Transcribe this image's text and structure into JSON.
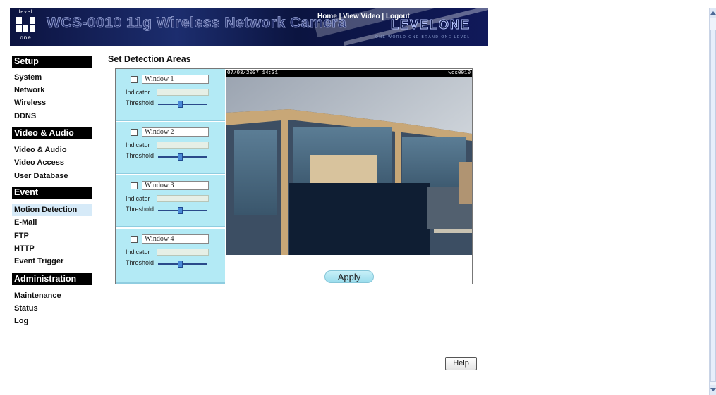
{
  "header": {
    "logo": {
      "top_text": "level",
      "bottom_text": "one"
    },
    "product_title": "WCS-0010 11g Wireless Network Camera",
    "brand": "LEVELONE",
    "tagline": "ONE WORLD ONE BRAND ONE LEVEL",
    "nav": [
      "Home",
      "View Video",
      "Logout"
    ]
  },
  "sidebar": {
    "sections": [
      {
        "title": "Setup",
        "items": [
          "System",
          "Network",
          "Wireless",
          "DDNS"
        ]
      },
      {
        "title": "Video & Audio",
        "items": [
          "Video & Audio",
          "Video Access",
          "User Database"
        ]
      },
      {
        "title": "Event",
        "items": [
          "Motion Detection",
          "E-Mail",
          "FTP",
          "HTTP",
          "Event Trigger"
        ]
      },
      {
        "title": "Administration",
        "items": [
          "Maintenance",
          "Status",
          "Log"
        ]
      }
    ],
    "active_item": "Motion Detection"
  },
  "main": {
    "title": "Set Detection Areas",
    "windows": [
      {
        "name": "Window 1",
        "checked": false,
        "indicator_label": "Indicator",
        "threshold_label": "Threshold",
        "threshold_level": 0.45
      },
      {
        "name": "Window 2",
        "checked": false,
        "indicator_label": "Indicator",
        "threshold_label": "Threshold",
        "threshold_level": 0.45
      },
      {
        "name": "Window 3",
        "checked": false,
        "indicator_label": "Indicator",
        "threshold_label": "Threshold",
        "threshold_level": 0.45
      },
      {
        "name": "Window 4",
        "checked": false,
        "indicator_label": "Indicator",
        "threshold_label": "Threshold",
        "threshold_level": 0.45
      }
    ],
    "camera": {
      "timestamp": "07/03/2007 14:31",
      "camera_id": "wcs0010"
    },
    "apply_label": "Apply",
    "help_label": "Help"
  },
  "colors": {
    "panel_bg": "#b3eaf5",
    "active_item_bg": "#d6eaf8",
    "section_bg": "#000000"
  }
}
